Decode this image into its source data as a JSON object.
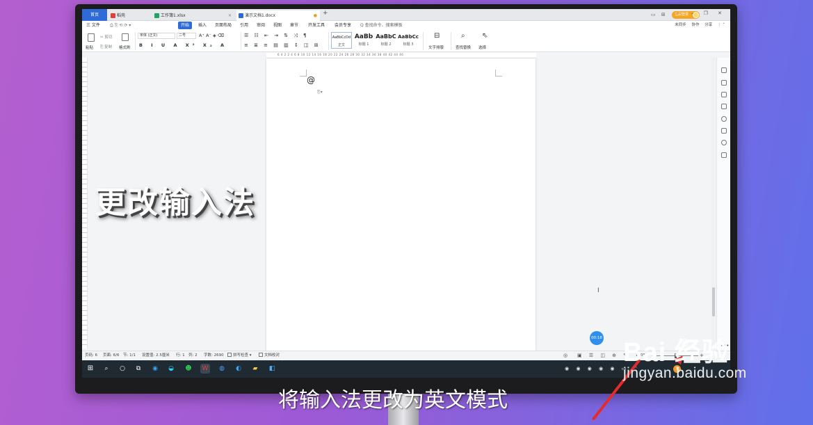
{
  "tabs": [
    {
      "label": "首页"
    },
    {
      "label": "稻壳"
    },
    {
      "label": "工作簿1.xlsx"
    },
    {
      "label": "演示文档1.docx"
    }
  ],
  "new_tab": "+",
  "login_label": "立即登录",
  "menu": {
    "file": "三 文件",
    "items": [
      "开始",
      "插入",
      "页面布局",
      "引用",
      "审阅",
      "视图",
      "章节",
      "开发工具",
      "会员专享"
    ],
    "active": "开始",
    "search": "Q 查找命令、搜索模板",
    "right": [
      "未同步",
      "协作",
      "分享"
    ]
  },
  "ribbon": {
    "paste": "粘贴",
    "cut": "剪切",
    "copy": "复制",
    "format_painter": "格式刷",
    "font_name": "宋体 (正文)",
    "font_size": "二号",
    "format_row": "B I U A X² X₂ A",
    "styles": [
      {
        "preview": "AaBbCcDd",
        "label": "正文"
      },
      {
        "preview": "AaBb",
        "label": "标题 1"
      },
      {
        "preview": "AaBbC",
        "label": "标题 2"
      },
      {
        "preview": "AaBbCc",
        "label": "标题 3"
      }
    ],
    "text_layout": "文字排版",
    "find_replace": "查找替换",
    "select": "选择"
  },
  "ruler_ticks": "6  4  2     2  4  6  8  10  12  14  16  18  20  22  24  26  28  30  32  34  36  38  40  42  44  46",
  "document": {
    "at_sign": "@"
  },
  "timer": "00:18",
  "status": {
    "page_num": "页码: 6",
    "pages": "页面: 6/6",
    "section": "节: 1/1",
    "settings": "设置值: 2.5厘米",
    "row": "行: 1",
    "col": "列: 2",
    "words": "字数: 2690",
    "spell": "拼写检查",
    "proof": "文档校对",
    "zoom": "100%"
  },
  "overlay": {
    "title": "更改输入法",
    "subtitle": "将输入法更改为英文模式"
  },
  "watermark": {
    "logo": "Bai  经验",
    "url": "jingyan.baidu.com"
  },
  "colors": {
    "accent": "#2f6bd8",
    "timer": "#2f8ef0",
    "pointer": "#e32b2b",
    "login": "#f5a623"
  }
}
